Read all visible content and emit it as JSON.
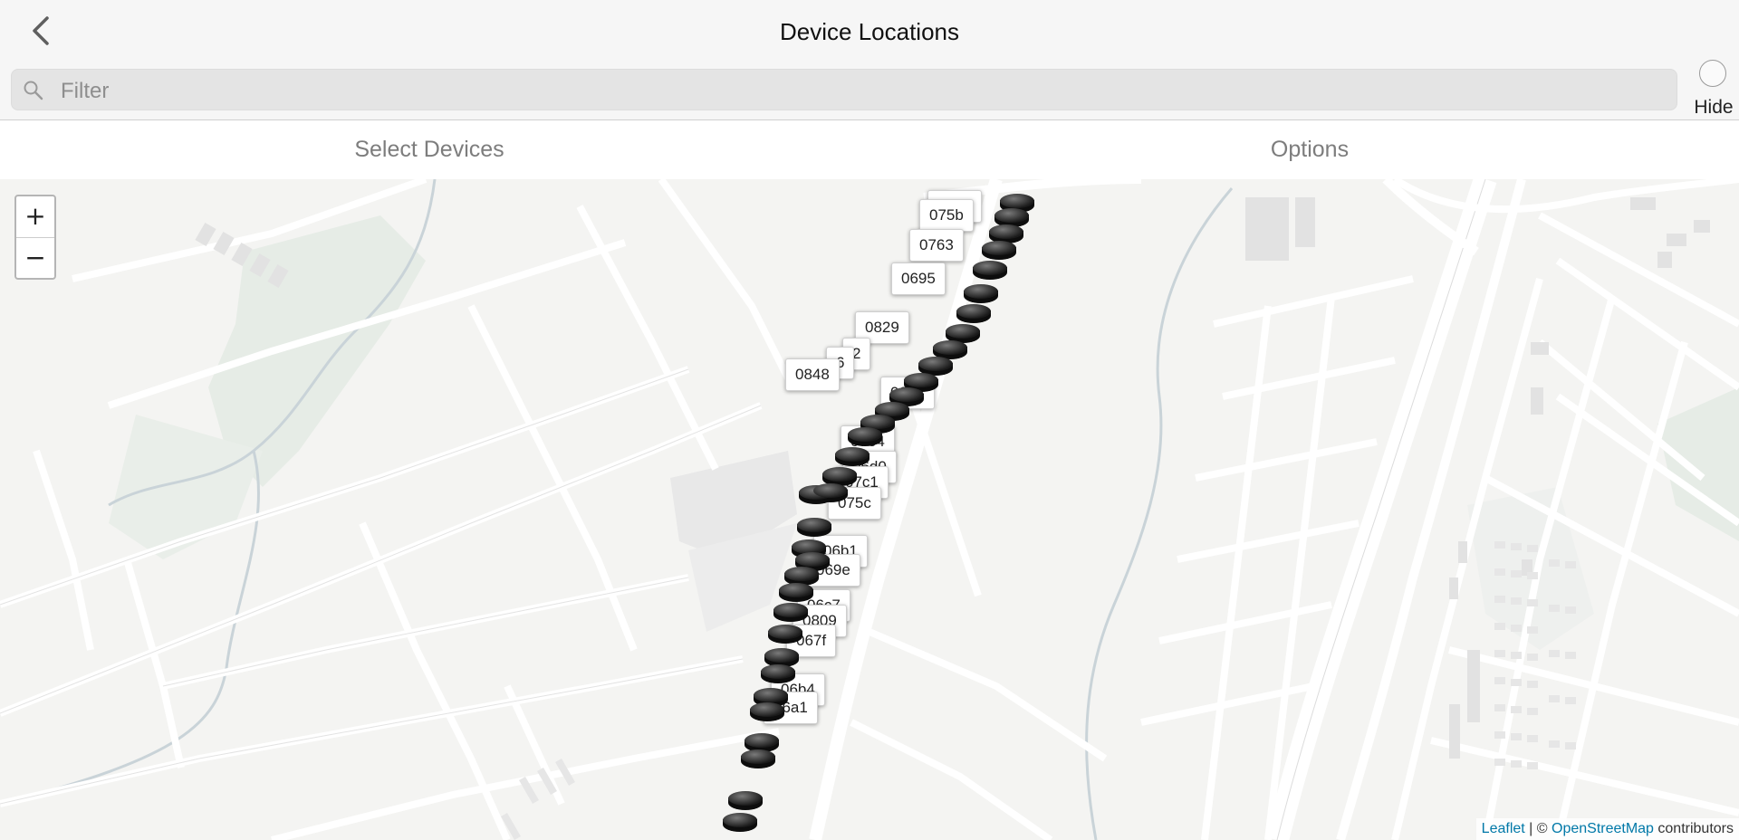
{
  "header": {
    "title": "Device Locations",
    "back_icon": "chevron-left-icon",
    "hide_label": "Hide"
  },
  "search": {
    "placeholder": "Filter",
    "value": "",
    "icon": "search-icon"
  },
  "tabs": [
    {
      "label": "Select Devices"
    },
    {
      "label": "Options"
    }
  ],
  "map": {
    "zoom_in": "+",
    "zoom_out": "−",
    "attribution": {
      "leaflet": "Leaflet",
      "separator": " | © ",
      "osm": "OpenStreetMap",
      "suffix": " contributors"
    },
    "device_labels": [
      "06b5",
      "075b",
      "0763",
      "0695",
      "0829",
      "2",
      "6",
      "0848",
      "0692",
      "07e4",
      "06d0",
      "07c1",
      "075c",
      "06b1",
      "069e",
      "06c7",
      "0809",
      "067f",
      "06b4",
      "06a1"
    ]
  }
}
